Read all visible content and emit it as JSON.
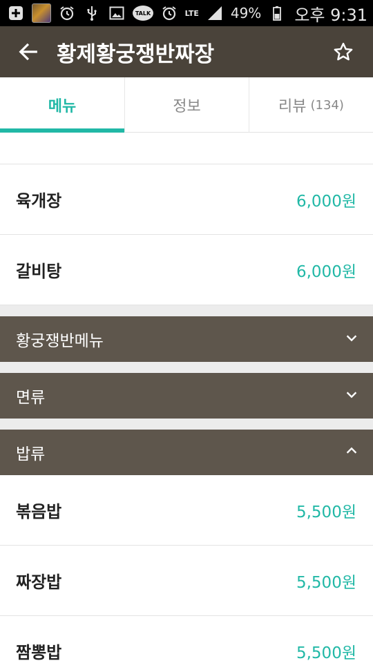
{
  "status_bar": {
    "icons_left": [
      "add-icon",
      "app-thumbnail",
      "alarm-icon",
      "usb-icon",
      "gallery-icon",
      "kakaotalk-icon"
    ],
    "talk_label": "TALK",
    "network": "LTE",
    "battery": "49%",
    "time": "오후 9:31"
  },
  "app_bar": {
    "title": "황제황궁쟁반짜장",
    "back_icon": "arrow-left-icon",
    "favorite_icon": "star-outline-icon"
  },
  "tabs": [
    {
      "label": "메뉴",
      "active": true
    },
    {
      "label": "정보",
      "active": false
    },
    {
      "label": "리뷰",
      "count": "(134)",
      "active": false
    }
  ],
  "menu": {
    "top_items": [
      {
        "name": "육개장",
        "price": "6,000원"
      },
      {
        "name": "갈비탕",
        "price": "6,000원"
      }
    ],
    "categories": [
      {
        "label": "황궁쟁반메뉴",
        "expanded": false
      },
      {
        "label": "면류",
        "expanded": false
      },
      {
        "label": "밥류",
        "expanded": true
      }
    ],
    "rice_items": [
      {
        "name": "볶음밥",
        "price": "5,500원"
      },
      {
        "name": "짜장밥",
        "price": "5,500원"
      },
      {
        "name": "짬뽕밥",
        "price": "5,500원"
      }
    ]
  },
  "colors": {
    "accent": "#21b8a6",
    "app_bar": "#4a433a",
    "category_bar": "#5e564c"
  }
}
